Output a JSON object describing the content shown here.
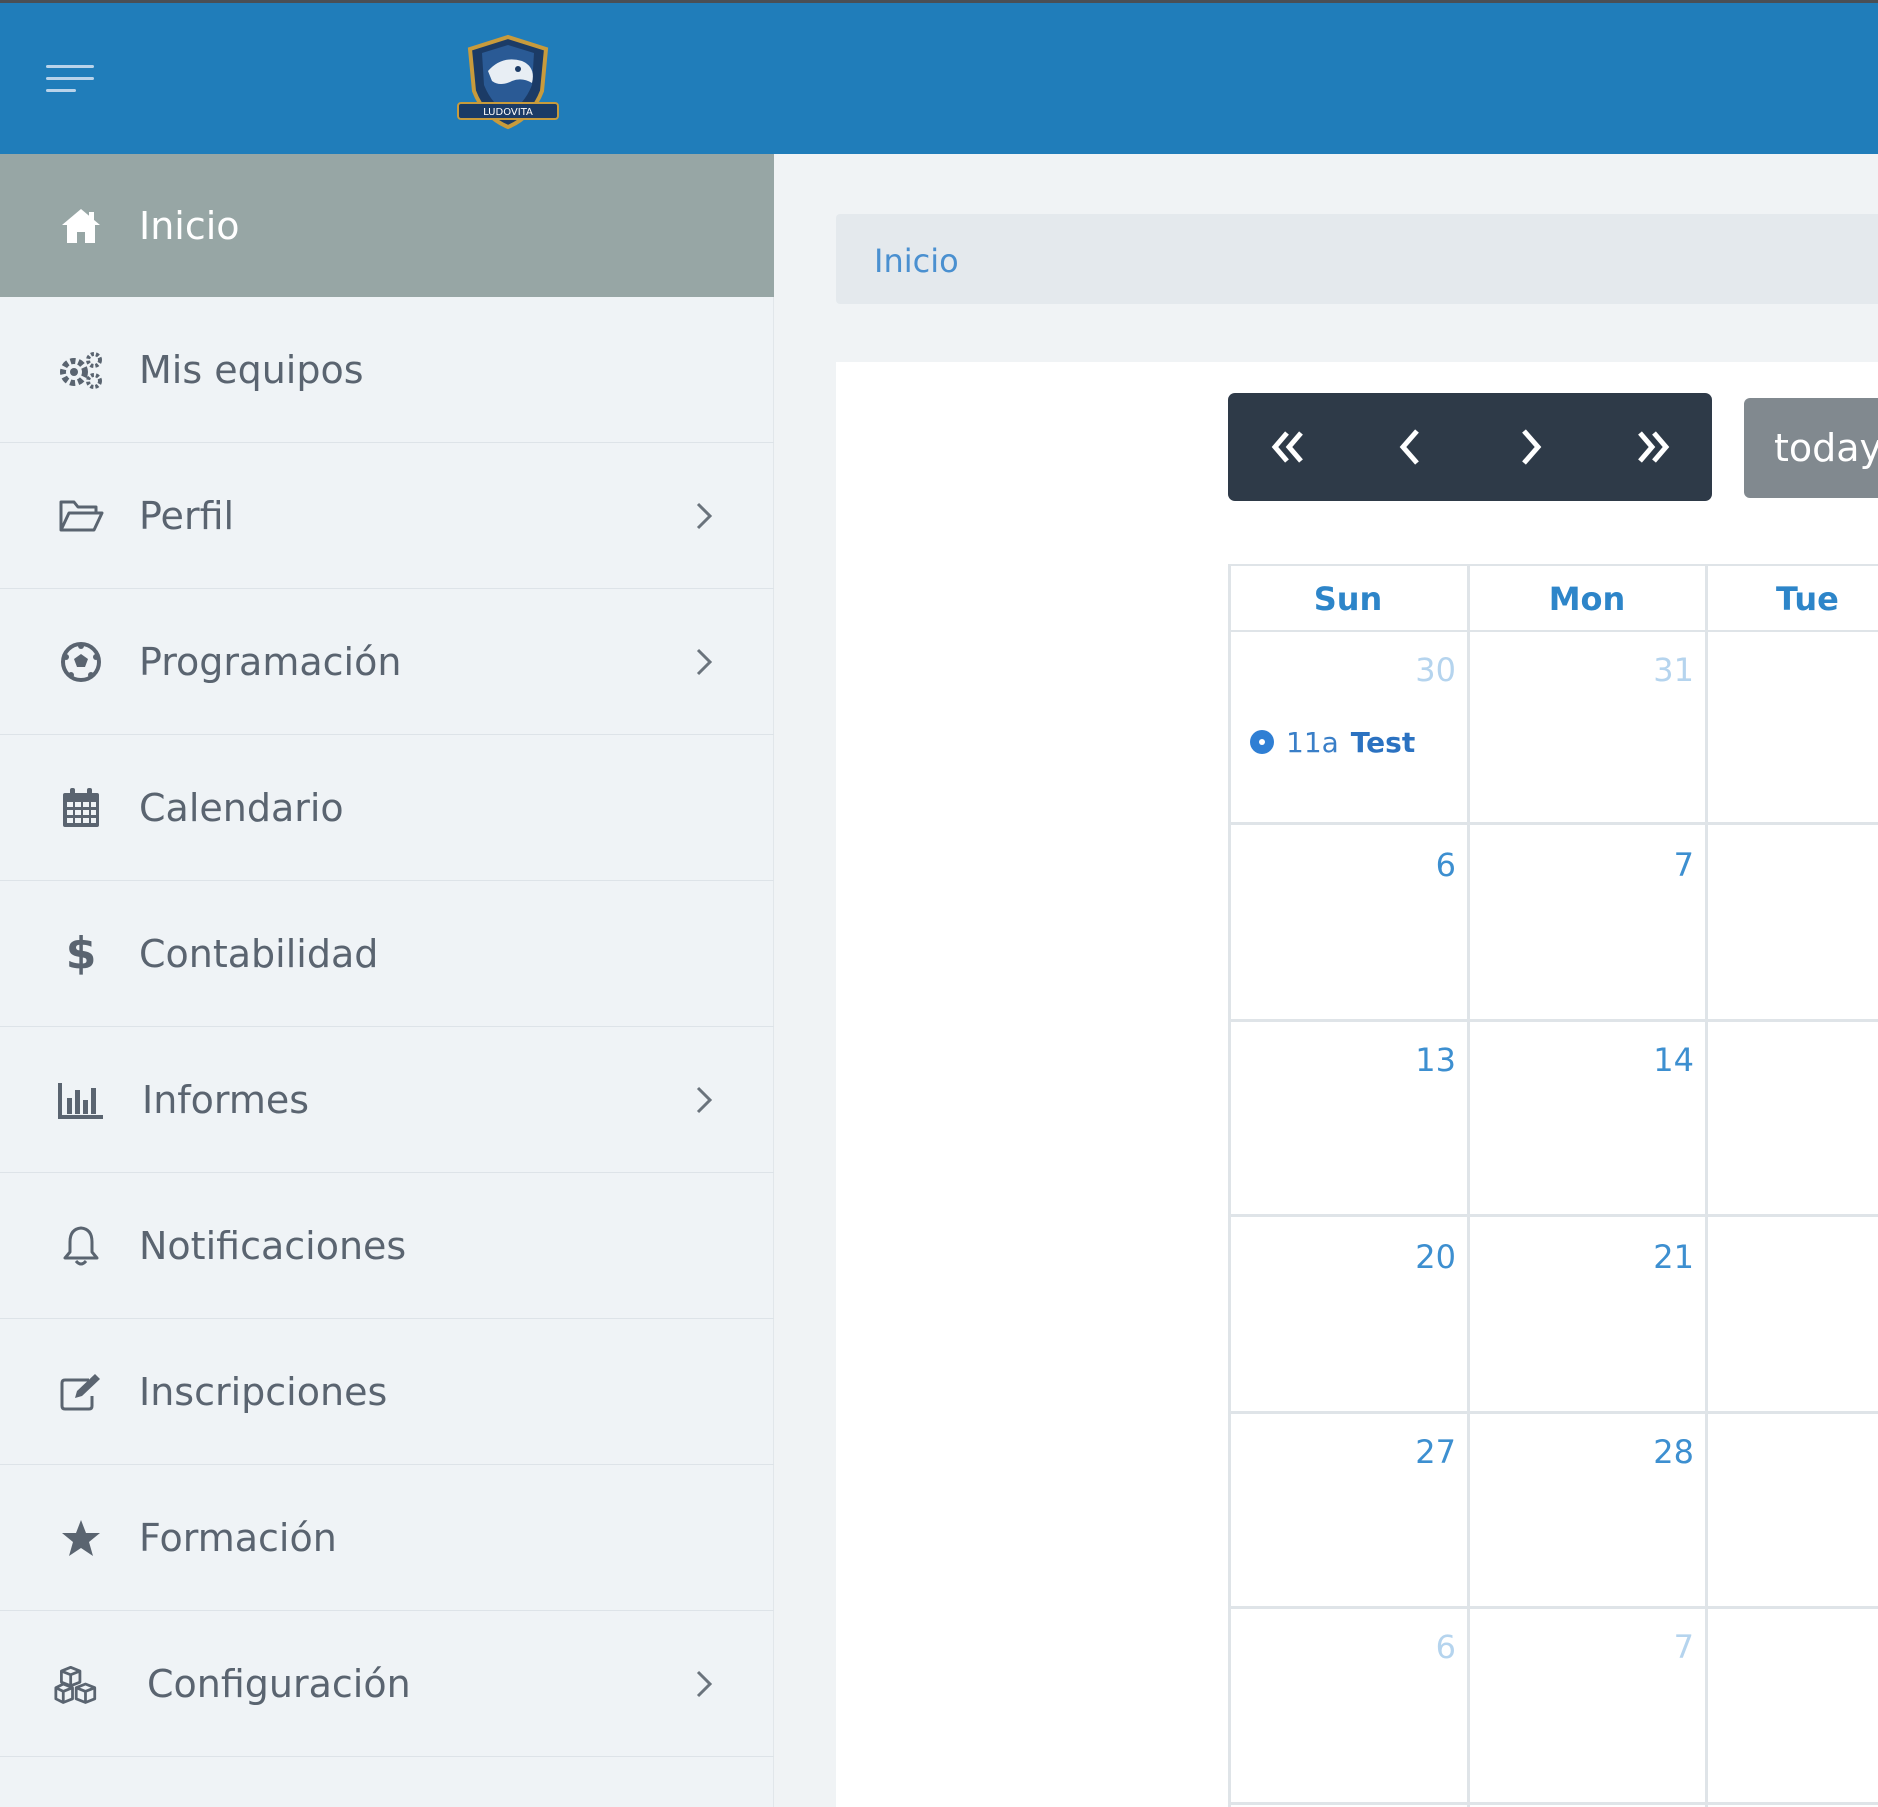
{
  "header": {
    "logo_text": "LUDOVITA",
    "colors": {
      "bar": "#207dba",
      "top_border": "#4a4f55"
    }
  },
  "sidebar": {
    "items": [
      {
        "label": "Inicio",
        "icon": "home-icon",
        "active": true,
        "has_submenu": false
      },
      {
        "label": "Mis equipos",
        "icon": "gears-icon",
        "active": false,
        "has_submenu": false
      },
      {
        "label": "Perfil",
        "icon": "folder-open-icon",
        "active": false,
        "has_submenu": true
      },
      {
        "label": "Programación",
        "icon": "soccer-ball-icon",
        "active": false,
        "has_submenu": true
      },
      {
        "label": "Calendario",
        "icon": "calendar-icon",
        "active": false,
        "has_submenu": false
      },
      {
        "label": "Contabilidad",
        "icon": "dollar-icon",
        "active": false,
        "has_submenu": false
      },
      {
        "label": "Informes",
        "icon": "bar-chart-icon",
        "active": false,
        "has_submenu": true
      },
      {
        "label": "Notificaciones",
        "icon": "bell-icon",
        "active": false,
        "has_submenu": false
      },
      {
        "label": "Inscripciones",
        "icon": "edit-icon",
        "active": false,
        "has_submenu": false
      },
      {
        "label": "Formación",
        "icon": "star-icon",
        "active": false,
        "has_submenu": false
      },
      {
        "label": "Configuración",
        "icon": "cubes-icon",
        "active": false,
        "has_submenu": true
      }
    ],
    "colors": {
      "active_bg": "#97a6a5",
      "bg": "#eff3f6"
    }
  },
  "breadcrumb": {
    "items": [
      "Inicio"
    ]
  },
  "calendar": {
    "toolbar": {
      "prev_year": "«",
      "prev": "‹",
      "next": "›",
      "next_year": "»",
      "today": "today"
    },
    "weekdays": [
      "Sun",
      "Mon",
      "Tue"
    ],
    "weeks": [
      [
        {
          "day": "30",
          "other_month": true
        },
        {
          "day": "31",
          "other_month": true
        }
      ],
      [
        {
          "day": "6",
          "other_month": false
        },
        {
          "day": "7",
          "other_month": false
        }
      ],
      [
        {
          "day": "13",
          "other_month": false
        },
        {
          "day": "14",
          "other_month": false
        }
      ],
      [
        {
          "day": "20",
          "other_month": false
        },
        {
          "day": "21",
          "other_month": false
        }
      ],
      [
        {
          "day": "27",
          "other_month": false
        },
        {
          "day": "28",
          "other_month": false
        }
      ],
      [
        {
          "day": "6",
          "other_month": true
        },
        {
          "day": "7",
          "other_month": true
        }
      ]
    ],
    "events": [
      {
        "time": "11a",
        "title": "Test"
      }
    ],
    "colors": {
      "header_text": "#2d85c9",
      "day_number": "#3d8fd0",
      "other_month": "#b5d4ee",
      "event": "#2f7fd4"
    }
  }
}
